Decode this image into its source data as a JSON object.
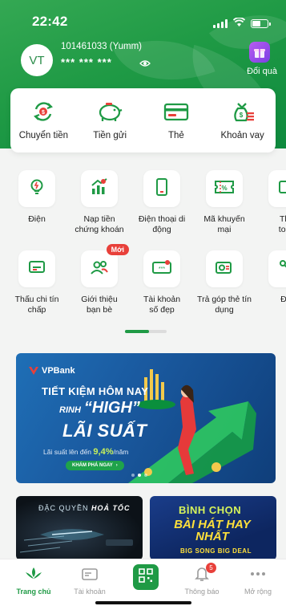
{
  "status_bar": {
    "time": "22:42"
  },
  "header": {
    "avatar_initials": "VT",
    "account_number": "101461033 (Yumm)",
    "balance_masked": "*** *** ***",
    "gift_label": "Đổi quà"
  },
  "quick_actions": [
    {
      "label": "Chuyển tiền",
      "icon": "transfer-icon"
    },
    {
      "label": "Tiền gửi",
      "icon": "piggy-bank-icon"
    },
    {
      "label": "Thẻ",
      "icon": "card-icon"
    },
    {
      "label": "Khoản vay",
      "icon": "money-bag-icon"
    }
  ],
  "services": [
    {
      "label": "Điện",
      "icon": "bulb-icon"
    },
    {
      "label": "Nạp tiền chứng khoán",
      "icon": "stocks-icon"
    },
    {
      "label": "Điện thoại di động",
      "icon": "phone-icon"
    },
    {
      "label": "Mã khuyến mại",
      "icon": "voucher-icon"
    },
    {
      "label": "Tha toán",
      "icon": "payment-icon"
    },
    {
      "label": "Thấu chi tín chấp",
      "icon": "overdraft-icon"
    },
    {
      "label": "Giới thiệu bạn bè",
      "icon": "referral-icon",
      "badge": "Mới"
    },
    {
      "label": "Tài khoản số đẹp",
      "icon": "nice-number-icon"
    },
    {
      "label": "Trả góp thẻ tín dụng",
      "icon": "installment-icon"
    },
    {
      "label": "Đổi",
      "icon": "exchange-icon"
    }
  ],
  "banner": {
    "brand": "VPBank",
    "line1": "TIẾT KIỆM HÔM NAY",
    "line2_prefix": "RINH",
    "line2_highlight": "“HIGH”",
    "line3": "LÃI SUẤT",
    "line4_prefix": "Lãi suất lên đến",
    "line4_rate": "9,4%",
    "line4_suffix": "/năm",
    "cta": "KHÁM PHÁ NGAY"
  },
  "promos": [
    {
      "title_prefix": "ĐẶC QUYỀN",
      "title_emph": "HOẢ TỐC"
    },
    {
      "line1": "BÌNH CHỌN",
      "line2": "BÀI HÁT HAY NHẤT",
      "line3": "BIG SONG BIG DEAL"
    }
  ],
  "bottom_nav": [
    {
      "label": "Trang chủ",
      "icon": "home-icon"
    },
    {
      "label": "Tài khoản",
      "icon": "account-icon"
    },
    {
      "label": "",
      "icon": "qr-icon"
    },
    {
      "label": "Thông báo",
      "icon": "bell-icon",
      "badge": "5"
    },
    {
      "label": "Mở rộng",
      "icon": "more-icon"
    }
  ],
  "colors": {
    "primary": "#1f9a45",
    "badge": "#e8403a",
    "banner": "#1a5aa0"
  }
}
